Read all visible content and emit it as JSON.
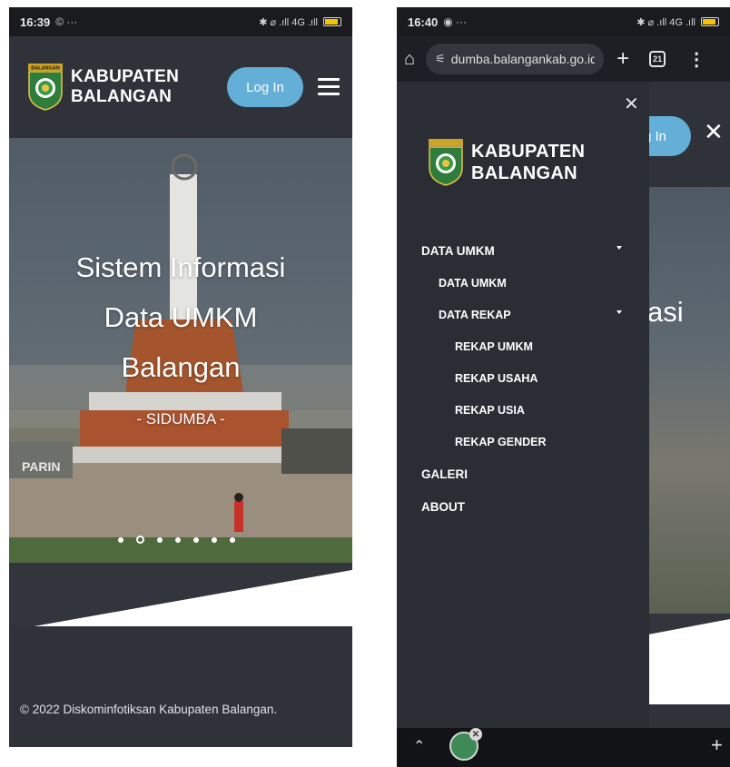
{
  "screens": [
    {
      "status": {
        "time": "16:39",
        "extra": "© ···",
        "icons": "✱ ⌀ .ıll 4G .ıll"
      },
      "header": {
        "logo_line1": "KABUPATEN",
        "logo_line2": "BALANGAN",
        "login_label": "Log In",
        "emblem_label": "BALANGAN"
      },
      "hero": {
        "title_line1": "Sistem Informasi",
        "title_line2": "Data UMKM",
        "title_line3": "Balangan",
        "subtitle": "- SIDUMBA -",
        "monument_text": "PARIN",
        "slide_count": 7,
        "active_slide": 2
      },
      "footer": {
        "copyright": "© 2022 Diskominfotiksan Kabupaten Balangan."
      }
    },
    {
      "status": {
        "time": "16:40",
        "extra": "◉ ···",
        "icons": "✱ ⌀ .ıll 4G .ıll"
      },
      "browser": {
        "url": "dumba.balangankab.go.id",
        "tab_count": "21"
      },
      "drawer": {
        "logo_line1": "KABUPATEN",
        "logo_line2": "BALANGAN",
        "menu": [
          {
            "label": "DATA UMKM",
            "level": 0,
            "caret": true
          },
          {
            "label": "DATA UMKM",
            "level": 1,
            "caret": false
          },
          {
            "label": "DATA REKAP",
            "level": 1,
            "caret": true
          },
          {
            "label": "REKAP UMKM",
            "level": 2,
            "caret": false
          },
          {
            "label": "REKAP USAHA",
            "level": 2,
            "caret": false
          },
          {
            "label": "REKAP USIA",
            "level": 2,
            "caret": false
          },
          {
            "label": "REKAP GENDER",
            "level": 2,
            "caret": false
          },
          {
            "label": "GALERI",
            "level": 0,
            "caret": false
          },
          {
            "label": "ABOUT",
            "level": 0,
            "caret": false
          }
        ]
      },
      "background_page": {
        "login_partial": "g In",
        "hero_partial": "asi"
      }
    }
  ],
  "colors": {
    "header_bg": "#2f3339",
    "login_btn": "#63afd8",
    "drawer_bg": "#2a2d33",
    "status_bg": "#1a1b1f"
  }
}
